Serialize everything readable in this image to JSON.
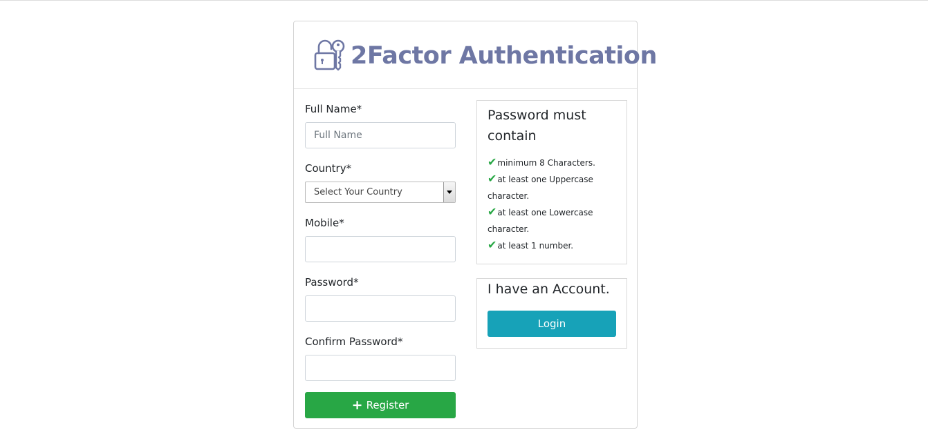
{
  "brand": {
    "title": "2Factor Authentication",
    "color": "#6e77a4",
    "icon": "padlock-key-icon"
  },
  "form": {
    "full_name_label": "Full Name*",
    "full_name_placeholder": "Full Name",
    "full_name_value": "",
    "country_label": "Country*",
    "country_selected": "Select Your Country",
    "mobile_label": "Mobile*",
    "mobile_value": "",
    "password_label": "Password*",
    "password_value": "",
    "confirm_password_label": "Confirm Password*",
    "confirm_password_value": "",
    "register_label": "Register",
    "register_icon": "plus-icon",
    "register_color": "#28a745"
  },
  "password_rules": {
    "title": "Password must contain",
    "check_icon": "check-icon",
    "check_color": "#28a745",
    "items": [
      "minimum 8 Characters.",
      "at least one Uppercase character.",
      "at least one Lowercase character.",
      "at least 1 number."
    ]
  },
  "account": {
    "title": "I have an Account.",
    "login_label": "Login",
    "login_color": "#17a2b8"
  }
}
